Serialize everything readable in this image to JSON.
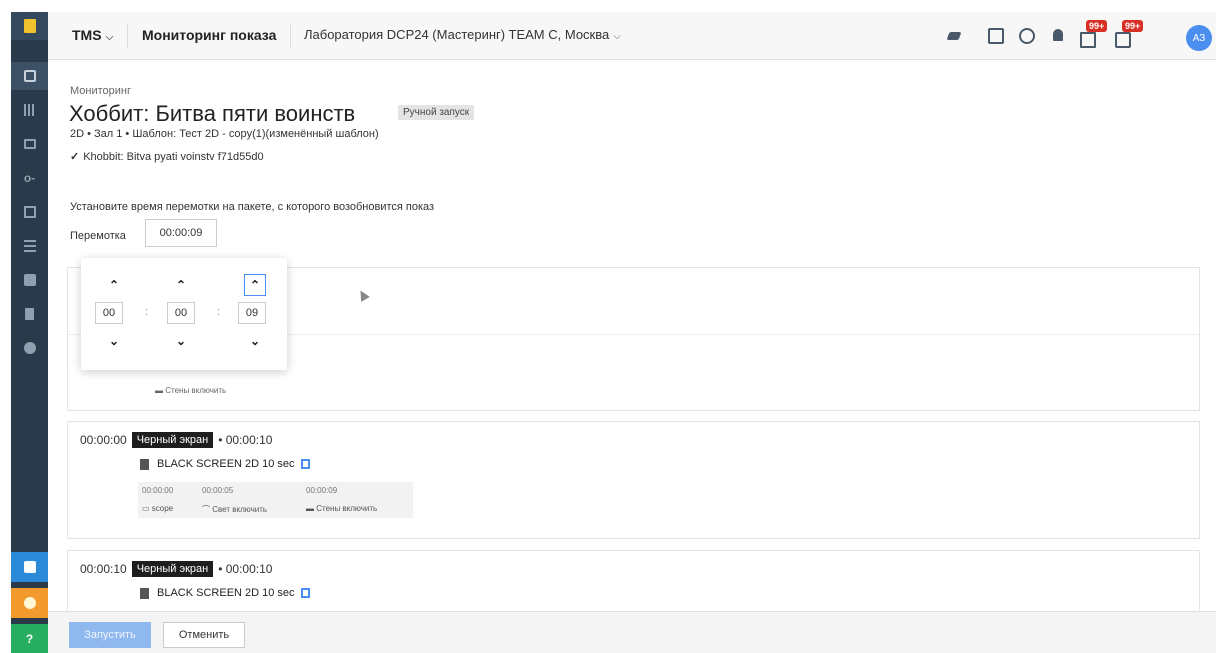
{
  "topbar": {
    "app": "TMS",
    "section": "Мониторинг показа",
    "location": "Лаборатория DCP24 (Мастеринг) TEAM C, Москва",
    "badge_docs": "99+",
    "badge_chat": "99+",
    "avatar": "АЗ"
  },
  "page": {
    "breadcrumb": "Мониторинг",
    "title": "Хоббит: Битва пяти воинств",
    "mode_tag": "Ручной запуск",
    "subline": "2D • Зал 1 • Шаблон: Тест 2D - copy(1)(изменённый шаблон)",
    "package": "Khobbit: Bitva pyati voinstv f71d55d0",
    "instruction": "Установите время перемотки на пакете, с которого возобновится показ",
    "rewind_label": "Перемотка",
    "rewind_value": "00:00:09"
  },
  "timepicker": {
    "hours": "00",
    "minutes": "00",
    "seconds": "09",
    "separator": ":"
  },
  "panel1": {
    "wall_label": "Стены включить"
  },
  "segments": [
    {
      "start": "00:00:00",
      "tag": "Черный экран",
      "duration": "• 00:00:10",
      "file": "BLACK SCREEN 2D 10 sec",
      "cues": [
        {
          "time": "00:00:00",
          "label": "scope"
        },
        {
          "time": "00:00:05",
          "label": "Свет включить"
        },
        {
          "time": "00:00:09",
          "label": "Стены включить"
        }
      ]
    },
    {
      "start": "00:00:10",
      "tag": "Черный экран",
      "duration": "• 00:00:10",
      "file": "BLACK SCREEN 2D 10 sec"
    }
  ],
  "footer": {
    "start": "Запустить",
    "cancel": "Отменить"
  },
  "colors": {
    "sidebar": "#2b3a4a",
    "accent": "#4a8ef0",
    "badge": "#d93025",
    "start_disabled": "#8fb8ef"
  },
  "icons": [
    "logo-icon",
    "play-icon",
    "film-icon",
    "folder-icon",
    "key-icon",
    "calendar-icon",
    "list-icon",
    "briefcase-icon",
    "book-icon",
    "gear-icon",
    "chat-icon",
    "bulb-icon",
    "help-icon",
    "bird-icon",
    "tablet-icon",
    "history-icon",
    "bell-icon",
    "doc-icon",
    "chat-bubble-icon"
  ]
}
